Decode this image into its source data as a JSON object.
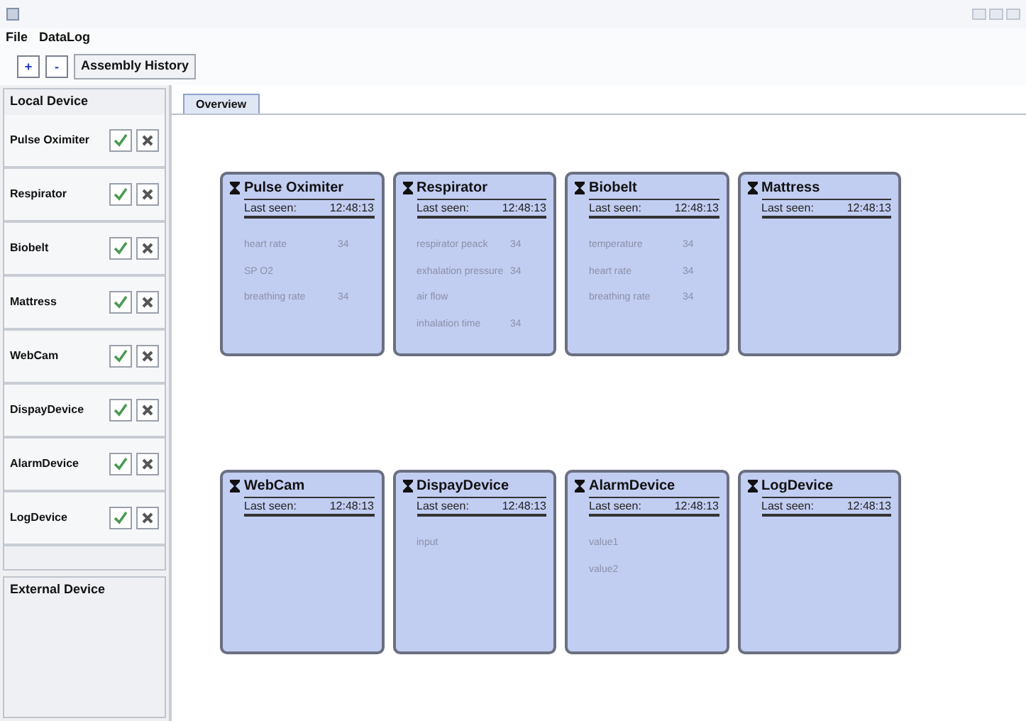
{
  "menu": [
    "File",
    "DataLog"
  ],
  "toolbar": {
    "add": "+",
    "remove": "-",
    "history": "Assembly History"
  },
  "local_device": {
    "title": "Local Device",
    "devices": [
      "Pulse Oximiter",
      "Respirator",
      "Biobelt",
      "Mattress",
      "WebCam",
      "DispayDevice",
      "AlarmDevice",
      "LogDevice"
    ]
  },
  "external_device": {
    "title": "External Device"
  },
  "tabs": [
    {
      "label": "Overview",
      "selected": true
    }
  ],
  "cards": [
    {
      "title": "Pulse Oximiter",
      "last_seen_label": "Last seen:",
      "last_seen": "12:48:13",
      "readings": [
        {
          "name": "heart rate",
          "value": "34"
        },
        {
          "name": "SP O2"
        },
        {
          "name": "breathing rate",
          "value": "34"
        }
      ]
    },
    {
      "title": "Respirator",
      "last_seen_label": "Last seen:",
      "last_seen": "12:48:13",
      "readings": [
        {
          "name": "respirator peack",
          "value": "34"
        },
        {
          "name": "exhalation pressure",
          "value": "34"
        },
        {
          "name": "air flow"
        },
        {
          "name": "inhalation time",
          "value": "34"
        }
      ]
    },
    {
      "title": "Biobelt",
      "last_seen_label": "Last seen:",
      "last_seen": "12:48:13",
      "readings": [
        {
          "name": "temperature",
          "value": "34"
        },
        {
          "name": "heart rate",
          "value": "34"
        },
        {
          "name": "breathing rate",
          "value": "34"
        }
      ]
    },
    {
      "title": "Mattress",
      "last_seen_label": "Last seen:",
      "last_seen": "12:48:13"
    },
    {
      "title": "WebCam",
      "last_seen_label": "Last seen:",
      "last_seen": "12:48:13"
    },
    {
      "title": "DispayDevice",
      "last_seen_label": "Last seen:",
      "last_seen": "12:48:13",
      "readings": [
        {
          "name": "input"
        }
      ]
    },
    {
      "title": "AlarmDevice",
      "last_seen_label": "Last seen:",
      "last_seen": "12:48:13",
      "readings": [
        {
          "name": "value1"
        },
        {
          "name": "value2"
        }
      ]
    },
    {
      "title": "LogDevice",
      "last_seen_label": "Last seen:",
      "last_seen": "12:48:13"
    }
  ]
}
